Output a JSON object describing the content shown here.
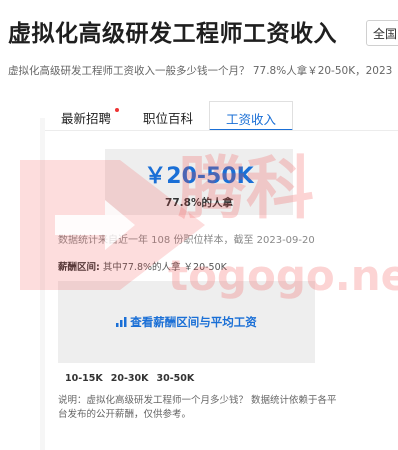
{
  "header": {
    "title": "虚拟化高级研发工程师工资收入",
    "location_button": "全国",
    "subtitle": "虚拟化高级研发工程师工资收入一般多少钱一个月？ 77.8%人拿￥20-50K，2023"
  },
  "tabs": [
    {
      "label": "最新招聘",
      "active": false,
      "has_dot": true
    },
    {
      "label": "职位百科",
      "active": false,
      "has_dot": false
    },
    {
      "label": "工资收入",
      "active": true,
      "has_dot": false
    }
  ],
  "salary": {
    "range": "￥20-50K",
    "share": "77.8%的人拿",
    "stat_line": "数据统计来自近一年 108 份职位样本，截至 2023-09-20",
    "range_label": "薪酬区间:",
    "range_detail": "其中77.8%的人拿 ￥20-50K"
  },
  "link": {
    "label": "查看薪酬区间与平均工资",
    "icon": "bar-chart-icon"
  },
  "ranges": [
    "10-15K",
    "20-30K",
    "30-50K"
  ],
  "note": "说明：虚拟化高级研发工程师一个月多少钱？ 数据统计依赖于各平台发布的公开薪酬，仅供参考。",
  "watermark": {
    "brand": "腾科",
    "url": "togogo.net"
  },
  "colors": {
    "accent": "#1a6fd6",
    "watermark": "#f04a4a",
    "dot": "#e33333"
  }
}
